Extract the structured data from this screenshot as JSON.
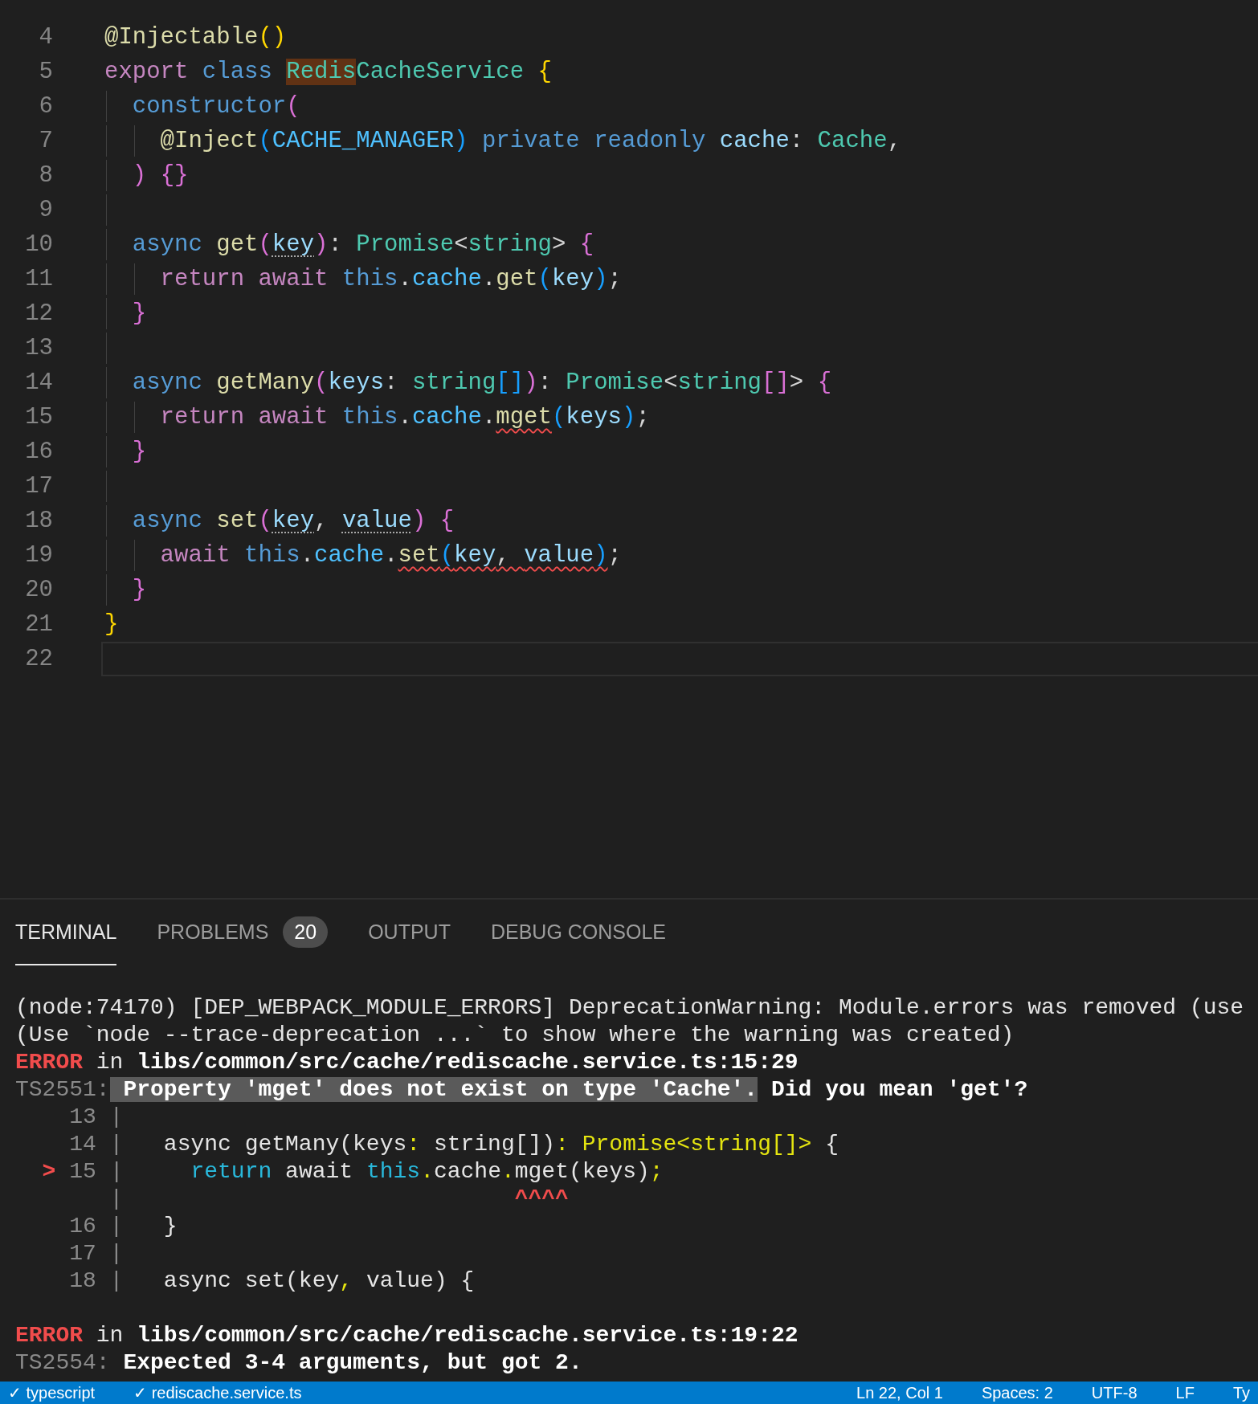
{
  "editor": {
    "lines": [
      {
        "number": "4",
        "current": false,
        "tokens": [
          {
            "text": "@Injectable",
            "kind": "func"
          },
          {
            "text": "()",
            "kind": "bracket1"
          }
        ]
      },
      {
        "number": "5",
        "current": false,
        "tokens": [
          {
            "text": "export ",
            "kind": "keyword"
          },
          {
            "text": "class ",
            "kind": "storage"
          },
          {
            "text": "Redis",
            "kind": "type",
            "find_match": true
          },
          {
            "text": "CacheService ",
            "kind": "type"
          },
          {
            "text": "{",
            "kind": "bracket1"
          }
        ]
      },
      {
        "number": "6",
        "current": false,
        "tokens": [
          {
            "text": "  constructor",
            "kind": "storage"
          },
          {
            "text": "(",
            "kind": "bracket2"
          }
        ]
      },
      {
        "number": "7",
        "current": false,
        "tokens": [
          {
            "text": "    @Inject",
            "kind": "func"
          },
          {
            "text": "(",
            "kind": "bracket3"
          },
          {
            "text": "CACHE_MANAGER",
            "kind": "const"
          },
          {
            "text": ") ",
            "kind": "bracket3"
          },
          {
            "text": "private ",
            "kind": "storage"
          },
          {
            "text": "readonly ",
            "kind": "storage"
          },
          {
            "text": "cache",
            "kind": "var"
          },
          {
            "text": ": ",
            "kind": "plain"
          },
          {
            "text": "Cache",
            "kind": "type"
          },
          {
            "text": ",",
            "kind": "plain"
          }
        ]
      },
      {
        "number": "8",
        "current": false,
        "tokens": [
          {
            "text": "  ) ",
            "kind": "bracket2"
          },
          {
            "text": "{}",
            "kind": "bracket2"
          }
        ]
      },
      {
        "number": "9",
        "current": false
      },
      {
        "number": "10",
        "current": false,
        "tokens": [
          {
            "text": "  async ",
            "kind": "storage"
          },
          {
            "text": "get",
            "kind": "func"
          },
          {
            "text": "(",
            "kind": "bracket2"
          },
          {
            "text": "key",
            "kind": "var",
            "hint": true
          },
          {
            "text": ")",
            "kind": "bracket2"
          },
          {
            "text": ": ",
            "kind": "plain"
          },
          {
            "text": "Promise",
            "kind": "type"
          },
          {
            "text": "<",
            "kind": "plain"
          },
          {
            "text": "string",
            "kind": "type"
          },
          {
            "text": "> ",
            "kind": "plain"
          },
          {
            "text": "{",
            "kind": "bracket2"
          }
        ]
      },
      {
        "number": "11",
        "current": false,
        "tokens": [
          {
            "text": "    return ",
            "kind": "keyword"
          },
          {
            "text": "await ",
            "kind": "keyword"
          },
          {
            "text": "this",
            "kind": "storage"
          },
          {
            "text": ".",
            "kind": "plain"
          },
          {
            "text": "cache",
            "kind": "const"
          },
          {
            "text": ".",
            "kind": "plain"
          },
          {
            "text": "get",
            "kind": "func"
          },
          {
            "text": "(",
            "kind": "bracket3"
          },
          {
            "text": "key",
            "kind": "var"
          },
          {
            "text": ")",
            "kind": "bracket3"
          },
          {
            "text": ";",
            "kind": "plain"
          }
        ]
      },
      {
        "number": "12",
        "current": false,
        "tokens": [
          {
            "text": "  }",
            "kind": "bracket2"
          }
        ]
      },
      {
        "number": "13",
        "current": false
      },
      {
        "number": "14",
        "current": false,
        "tokens": [
          {
            "text": "  async ",
            "kind": "storage"
          },
          {
            "text": "getMany",
            "kind": "func"
          },
          {
            "text": "(",
            "kind": "bracket2"
          },
          {
            "text": "keys",
            "kind": "var"
          },
          {
            "text": ": ",
            "kind": "plain"
          },
          {
            "text": "string",
            "kind": "type"
          },
          {
            "text": "[]",
            "kind": "bracket3"
          },
          {
            "text": ")",
            "kind": "bracket2"
          },
          {
            "text": ": ",
            "kind": "plain"
          },
          {
            "text": "Promise",
            "kind": "type"
          },
          {
            "text": "<",
            "kind": "plain"
          },
          {
            "text": "string",
            "kind": "type"
          },
          {
            "text": "[]",
            "kind": "bracket2"
          },
          {
            "text": "> ",
            "kind": "plain"
          },
          {
            "text": "{",
            "kind": "bracket2"
          }
        ]
      },
      {
        "number": "15",
        "current": false,
        "tokens": [
          {
            "text": "    return ",
            "kind": "keyword"
          },
          {
            "text": "await ",
            "kind": "keyword"
          },
          {
            "text": "this",
            "kind": "storage"
          },
          {
            "text": ".",
            "kind": "plain"
          },
          {
            "text": "cache",
            "kind": "const"
          },
          {
            "text": ".",
            "kind": "plain"
          },
          {
            "text": "mget",
            "kind": "func",
            "error": true
          },
          {
            "text": "(",
            "kind": "bracket3"
          },
          {
            "text": "keys",
            "kind": "var"
          },
          {
            "text": ")",
            "kind": "bracket3"
          },
          {
            "text": ";",
            "kind": "plain"
          }
        ]
      },
      {
        "number": "16",
        "current": false,
        "tokens": [
          {
            "text": "  }",
            "kind": "bracket2"
          }
        ]
      },
      {
        "number": "17",
        "current": false
      },
      {
        "number": "18",
        "current": false,
        "tokens": [
          {
            "text": "  async ",
            "kind": "storage"
          },
          {
            "text": "set",
            "kind": "func"
          },
          {
            "text": "(",
            "kind": "bracket2"
          },
          {
            "text": "key",
            "kind": "var",
            "hint": true
          },
          {
            "text": ", ",
            "kind": "plain"
          },
          {
            "text": "value",
            "kind": "var",
            "hint": true
          },
          {
            "text": ") ",
            "kind": "bracket2"
          },
          {
            "text": "{",
            "kind": "bracket2"
          }
        ]
      },
      {
        "number": "19",
        "current": false,
        "tokens": [
          {
            "text": "    await ",
            "kind": "keyword"
          },
          {
            "text": "this",
            "kind": "storage"
          },
          {
            "text": ".",
            "kind": "plain"
          },
          {
            "text": "cache",
            "kind": "const"
          },
          {
            "text": ".",
            "kind": "plain"
          },
          {
            "text": "set",
            "kind": "func",
            "error": true
          },
          {
            "text": "(",
            "kind": "bracket3",
            "error": true
          },
          {
            "text": "key",
            "kind": "var",
            "error": true
          },
          {
            "text": ", ",
            "kind": "plain",
            "error": true
          },
          {
            "text": "value",
            "kind": "var",
            "error": true
          },
          {
            "text": ")",
            "kind": "bracket3",
            "error": true
          },
          {
            "text": ";",
            "kind": "plain"
          }
        ]
      },
      {
        "number": "20",
        "current": false,
        "tokens": [
          {
            "text": "  }",
            "kind": "bracket2"
          }
        ]
      },
      {
        "number": "21",
        "current": false,
        "tokens": [
          {
            "text": "}",
            "kind": "bracket1"
          }
        ]
      },
      {
        "number": "22",
        "current": true
      }
    ]
  },
  "panel": {
    "tabs": [
      {
        "label": "TERMINAL",
        "selected": true
      },
      {
        "label": "PROBLEMS",
        "selected": false,
        "badge": "20"
      },
      {
        "label": "OUTPUT",
        "selected": false
      },
      {
        "label": "DEBUG CONSOLE",
        "selected": false
      }
    ],
    "terminal": [
      {
        "lines": [
          [
            {
              "text": "(node:74170) [DEP_WEBPACK_MODULE_ERRORS] DeprecationWarning: Module.errors was removed (use",
              "kind": "plain"
            }
          ],
          [
            {
              "text": "(Use `node --trace-deprecation ...` to show where the warning was created)",
              "kind": "plain"
            }
          ],
          [
            {
              "text": "ERROR",
              "kind": "red"
            },
            {
              "text": " in ",
              "kind": "plain"
            },
            {
              "text": "libs/common/src/cache/rediscache.service.ts:15:29",
              "kind": "bold"
            }
          ],
          [
            {
              "text": "TS2551:",
              "kind": "dim"
            },
            {
              "text": " Property 'mget' does not exist on type 'Cache'.",
              "kind": "highlight"
            },
            {
              "text": " Did you mean 'get'?",
              "kind": "bold"
            }
          ],
          [
            {
              "text": "    13 |",
              "kind": "dim"
            }
          ],
          [
            {
              "text": "    14 |",
              "kind": "dim"
            },
            {
              "text": "   async getMany(keys",
              "kind": "plain"
            },
            {
              "text": ":",
              "kind": "yellow"
            },
            {
              "text": " string[])",
              "kind": "plain"
            },
            {
              "text": ": Promise<string[]>",
              "kind": "yellow"
            },
            {
              "text": " {",
              "kind": "plain"
            }
          ],
          [
            {
              "text": "  >",
              "kind": "red"
            },
            {
              "text": " 15 |",
              "kind": "dim"
            },
            {
              "text": "     return",
              "kind": "cyan"
            },
            {
              "text": " await ",
              "kind": "plain"
            },
            {
              "text": "this",
              "kind": "cyan"
            },
            {
              "text": ".",
              "kind": "yellow"
            },
            {
              "text": "cache",
              "kind": "plain"
            },
            {
              "text": ".",
              "kind": "yellow"
            },
            {
              "text": "mget(keys)",
              "kind": "plain"
            },
            {
              "text": ";",
              "kind": "yellow"
            }
          ],
          [
            {
              "text": "       |",
              "kind": "dim"
            },
            {
              "text": "                             ^^^^",
              "kind": "red"
            }
          ],
          [
            {
              "text": "    16 |",
              "kind": "dim"
            },
            {
              "text": "   }",
              "kind": "plain"
            }
          ],
          [
            {
              "text": "    17 |",
              "kind": "dim"
            }
          ],
          [
            {
              "text": "    18 |",
              "kind": "dim"
            },
            {
              "text": "   async set(key",
              "kind": "plain"
            },
            {
              "text": ",",
              "kind": "yellow"
            },
            {
              "text": " value) {",
              "kind": "plain"
            }
          ]
        ]
      },
      {
        "lines": [
          [
            {
              "text": "ERROR",
              "kind": "red"
            },
            {
              "text": " in ",
              "kind": "plain"
            },
            {
              "text": "libs/common/src/cache/rediscache.service.ts:19:22",
              "kind": "bold"
            }
          ],
          [
            {
              "text": "TS2554:",
              "kind": "dim"
            },
            {
              "text": " Expected 3-4 arguments, but got 2.",
              "kind": "bold"
            }
          ]
        ]
      }
    ]
  },
  "status_bar": {
    "left": [
      "✓ typescript",
      "✓ rediscache.service.ts"
    ],
    "right": [
      "Ln 22, Col 1",
      "Spaces: 2",
      "UTF-8",
      "LF",
      "Ty"
    ]
  }
}
